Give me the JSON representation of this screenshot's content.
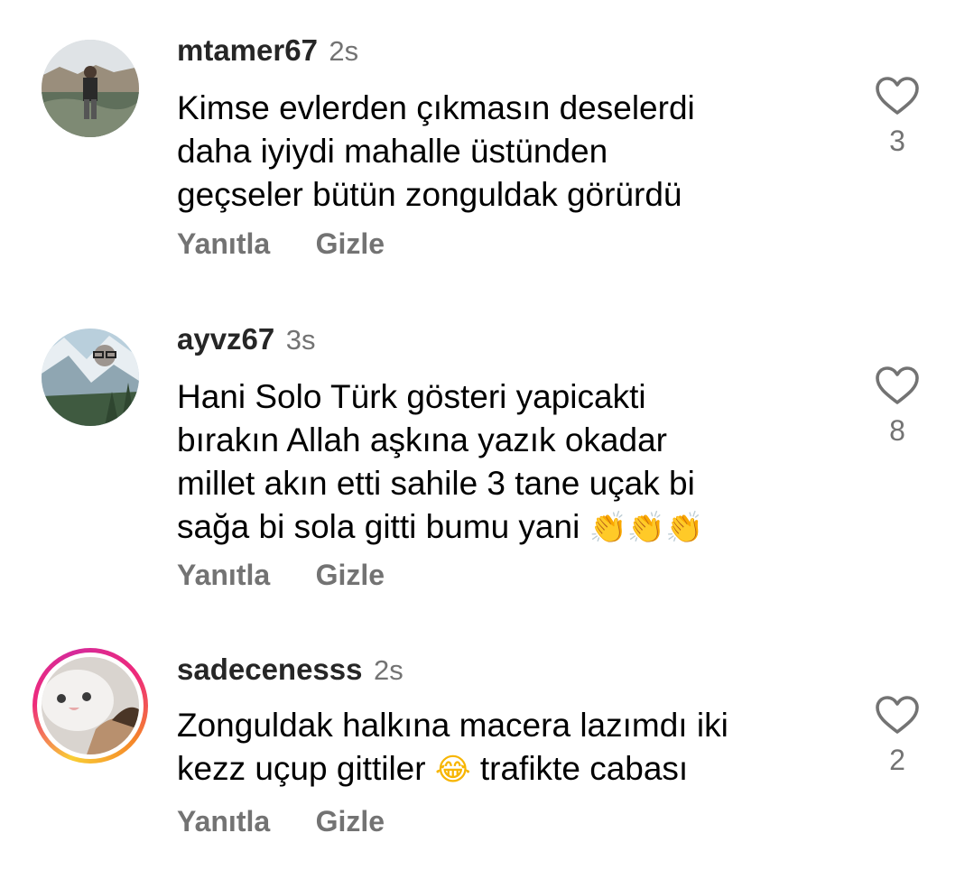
{
  "comments": [
    {
      "username": "mtamer67",
      "time": "2s",
      "text_lines": [
        "Kimse evlerden çıkmasın deselerdi",
        "daha iyiydi mahalle üstünden",
        "geçseler bütün zonguldak görürdü"
      ],
      "like_count": "3",
      "reply_label": "Yanıtla",
      "hide_label": "Gizle",
      "has_story": false
    },
    {
      "username": "ayvz67",
      "time": "3s",
      "text_lines": [
        "Hani Solo Türk gösteri yapicakti",
        "bırakın Allah aşkına yazık okadar",
        "millet akın etti sahile 3 tane uçak bi",
        "sağa bi sola gitti bumu yani"
      ],
      "emoji": "👏👏👏",
      "like_count": "8",
      "reply_label": "Yanıtla",
      "hide_label": "Gizle",
      "has_story": false
    },
    {
      "username": "sadecenesss",
      "time": "2s",
      "text_lines": [
        "Zonguldak halkına macera lazımdı iki",
        "kezz uçup gittiler"
      ],
      "emoji": "😂",
      "text_after_emoji": "trafikte cabası",
      "like_count": "2",
      "reply_label": "Yanıtla",
      "hide_label": "Gizle",
      "has_story": true
    }
  ],
  "icons": {
    "like": "heart-outline-icon"
  },
  "colors": {
    "username": "#262626",
    "secondary": "#737373",
    "text": "#000000"
  }
}
